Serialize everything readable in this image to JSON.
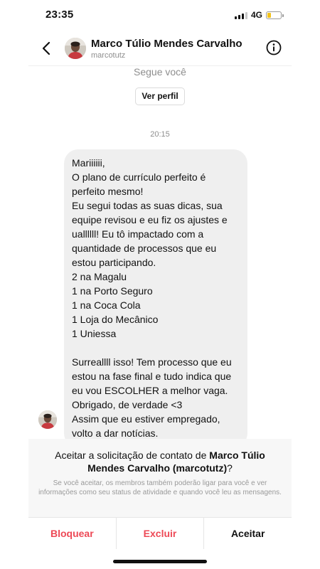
{
  "status_bar": {
    "time": "23:35",
    "network": "4G"
  },
  "header": {
    "name": "Marco Túlio Mendes Carvalho",
    "username": "marcotutz",
    "back_icon": "chevron-left-icon",
    "info_icon": "info-circle-icon"
  },
  "conversation": {
    "follows_you": "Segue você",
    "view_profile": "Ver perfil",
    "timestamp": "20:15",
    "message_lines": [
      "Mariiiiii,",
      "O plano de currículo perfeito é",
      "perfeito mesmo!",
      "Eu segui todas as suas dicas, sua",
      "equipe revisou e eu fiz os ajustes e",
      "uallllll! Eu tô impactado com a",
      "quantidade de processos que eu",
      "estou participando.",
      "2 na Magalu",
      "1 na Porto Seguro",
      "1 na Coca Cola",
      "1 Loja do Mecânico",
      "1 Uniessa",
      "",
      "Surreallll isso! Tem processo que eu",
      "estou na fase final e tudo indica que",
      "eu vou ESCOLHER a melhor vaga.",
      "Obrigado, de verdade <3",
      "Assim que eu estiver empregado,",
      "volto a dar notícias."
    ]
  },
  "request": {
    "title_prefix": "Aceitar a solicitação de contato de ",
    "title_name": "Marco Túlio Mendes Carvalho (marcotutz)",
    "title_suffix": "?",
    "note": "Se você aceitar, os membros também poderão ligar para você e ver informações como seu status de atividade e quando você leu as mensagens.",
    "actions": {
      "block": "Bloquear",
      "delete": "Excluir",
      "accept": "Aceitar"
    }
  },
  "colors": {
    "danger": "#ed4956",
    "bubble": "#efefef",
    "muted": "#8e8e8e",
    "battery": "#f2c21b"
  }
}
